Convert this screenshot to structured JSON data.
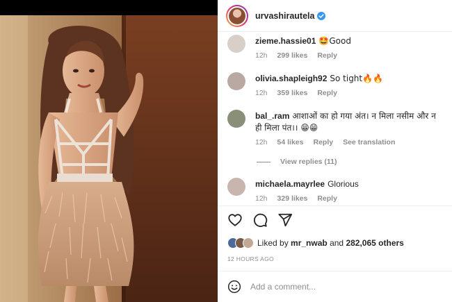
{
  "post": {
    "author": "urvashirautela",
    "verified": true
  },
  "comments": [
    {
      "user": "zieme.hassie01",
      "text": "🤩Good",
      "time": "12h",
      "likes": "299 likes",
      "reply": "Reply",
      "avatar_color": "#d8cfc8"
    },
    {
      "user": "olivia.shapleigh92",
      "text": "So tight🔥🔥",
      "time": "12h",
      "likes": "359 likes",
      "reply": "Reply",
      "avatar_color": "#b9a9a2"
    },
    {
      "user": "bal_.ram",
      "text": "आशाओं का हो गया अंत। न मिला नसीम और न ही मिला पंत।। 😁😁",
      "time": "12h",
      "likes": "54 likes",
      "reply": "Reply",
      "translation": "See translation",
      "avatar_color": "#8a8f7a"
    },
    {
      "user": "michaela.mayrlee",
      "text": "Glorious",
      "time": "12h",
      "likes": "329 likes",
      "reply": "Reply",
      "avatar_color": "#c7b5ae"
    }
  ],
  "view_replies": "View replies (11)",
  "likes": {
    "prefix": "Liked by",
    "user": "mr_nwab",
    "connector": "and",
    "count": "282,065 others"
  },
  "timestamp": "12 HOURS AGO",
  "add_comment": {
    "placeholder": "Add a comment..."
  },
  "icons": {
    "like": "heart-icon",
    "comment": "comment-icon",
    "share": "share-icon",
    "emoji": "emoji-icon",
    "verified": "verified-badge-icon"
  },
  "colors": {
    "accent_blue": "#3897f0",
    "muted": "#8e8e8e",
    "text": "#262626"
  }
}
